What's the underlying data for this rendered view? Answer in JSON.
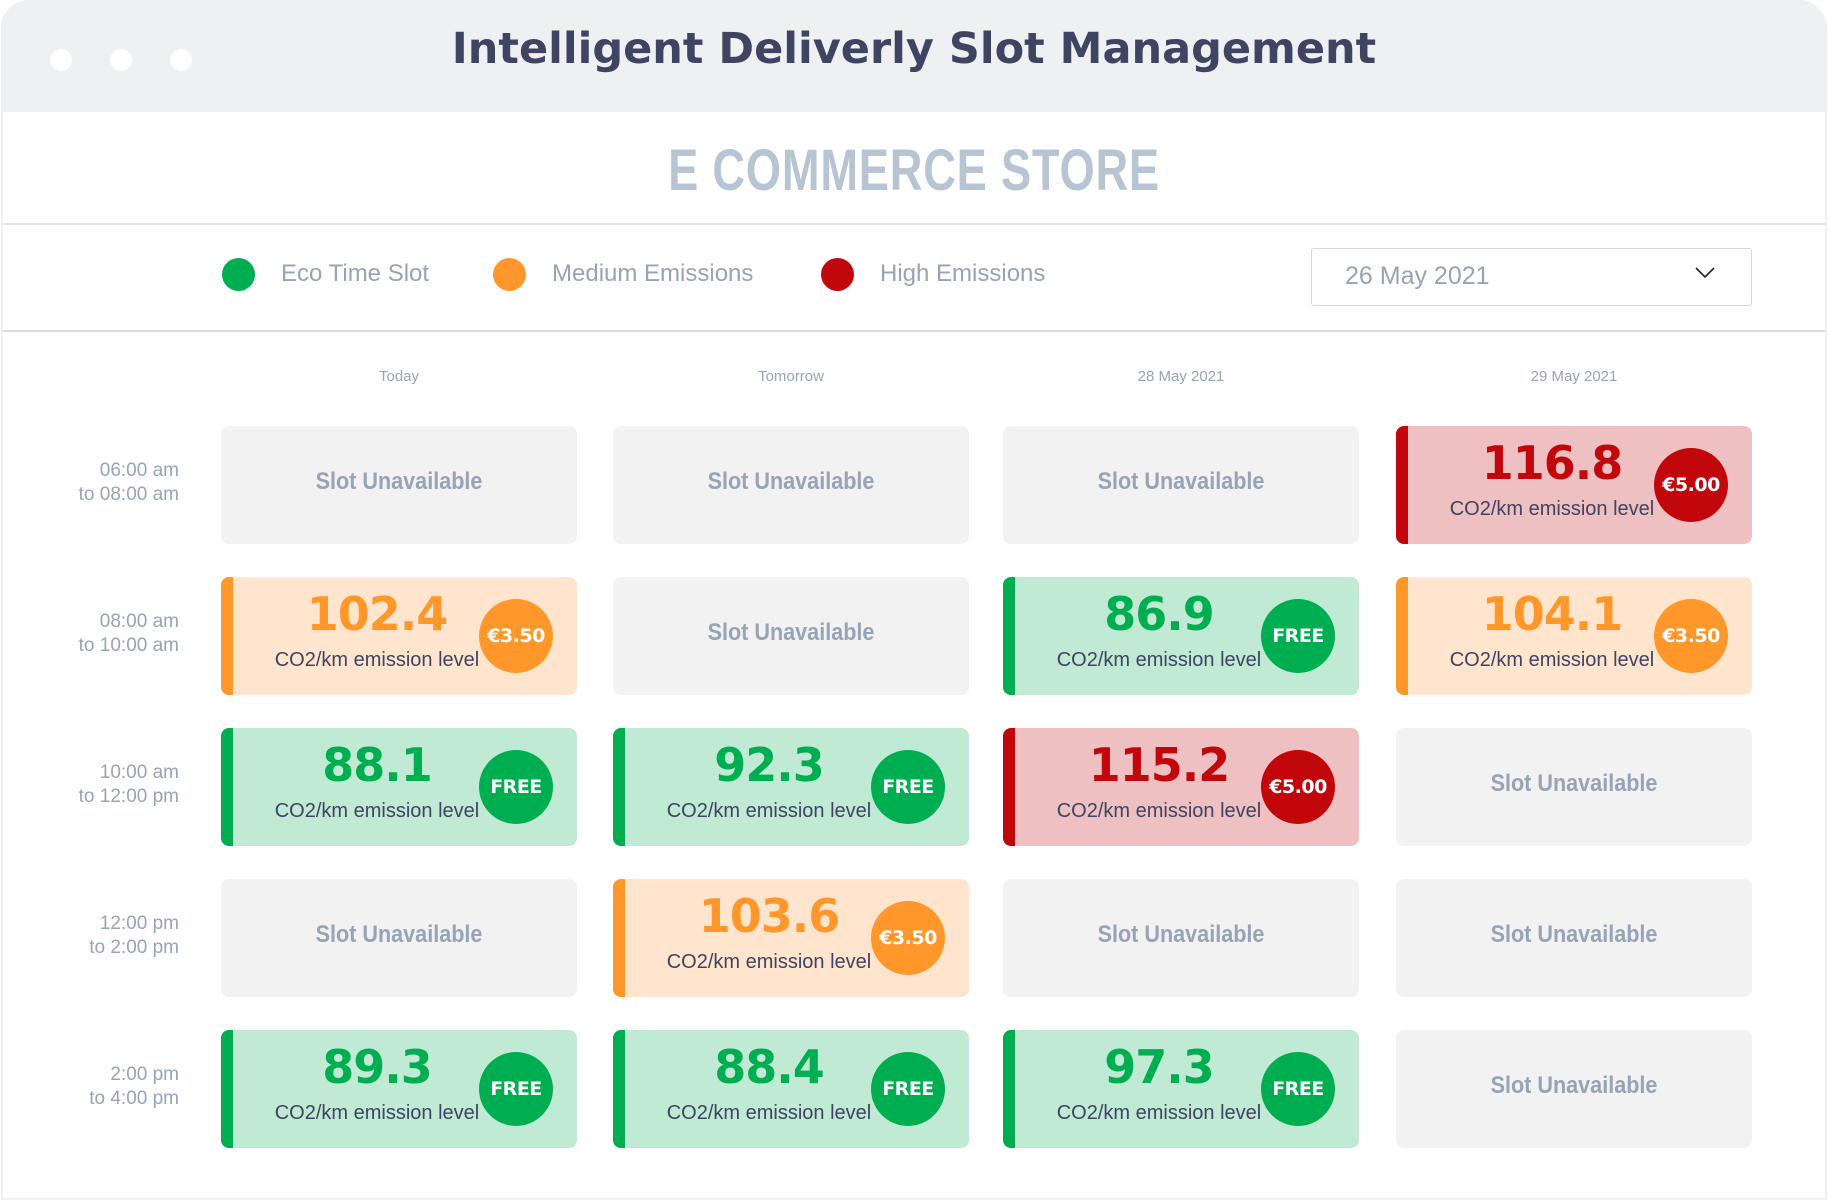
{
  "window": {
    "title": "Intelligent Deliverly Slot Management"
  },
  "store": {
    "title": "E COMMERCE STORE"
  },
  "legend": [
    {
      "label": "Eco Time Slot",
      "color": "#00ae52"
    },
    {
      "label": "Medium Emissions",
      "color": "#ff972a"
    },
    {
      "label": "High Emissions",
      "color": "#c1070b"
    }
  ],
  "date_select": {
    "value": "26 May 2021",
    "icon": "chevron-down-icon"
  },
  "columns": [
    "Today",
    "Tomorrow",
    "28 May 2021",
    "29 May 2021"
  ],
  "time_slots": [
    {
      "from": "06:00 am",
      "to": "to 08:00 am"
    },
    {
      "from": "08:00 am",
      "to": "to 10:00 am"
    },
    {
      "from": "10:00 am",
      "to": "to 12:00 pm"
    },
    {
      "from": "12:00 pm",
      "to": "to 2:00 pm"
    },
    {
      "from": "2:00 pm",
      "to": "to 4:00 pm"
    }
  ],
  "labels": {
    "unavailable": "Slot Unavailable",
    "unit": "CO2/km emission level"
  },
  "grid": [
    [
      {
        "status": "unavailable"
      },
      {
        "status": "unavailable"
      },
      {
        "status": "unavailable"
      },
      {
        "status": "high",
        "value": "116.8",
        "price": "€5.00"
      }
    ],
    [
      {
        "status": "medium",
        "value": "102.4",
        "price": "€3.50"
      },
      {
        "status": "unavailable"
      },
      {
        "status": "eco",
        "value": "86.9",
        "price": "FREE"
      },
      {
        "status": "medium",
        "value": "104.1",
        "price": "€3.50"
      }
    ],
    [
      {
        "status": "eco",
        "value": "88.1",
        "price": "FREE"
      },
      {
        "status": "eco",
        "value": "92.3",
        "price": "FREE"
      },
      {
        "status": "high",
        "value": "115.2",
        "price": "€5.00"
      },
      {
        "status": "unavailable"
      }
    ],
    [
      {
        "status": "unavailable"
      },
      {
        "status": "medium",
        "value": "103.6",
        "price": "€3.50"
      },
      {
        "status": "unavailable"
      },
      {
        "status": "unavailable"
      }
    ],
    [
      {
        "status": "eco",
        "value": "89.3",
        "price": "FREE"
      },
      {
        "status": "eco",
        "value": "88.4",
        "price": "FREE"
      },
      {
        "status": "eco",
        "value": "97.3",
        "price": "FREE"
      },
      {
        "status": "unavailable"
      }
    ]
  ]
}
